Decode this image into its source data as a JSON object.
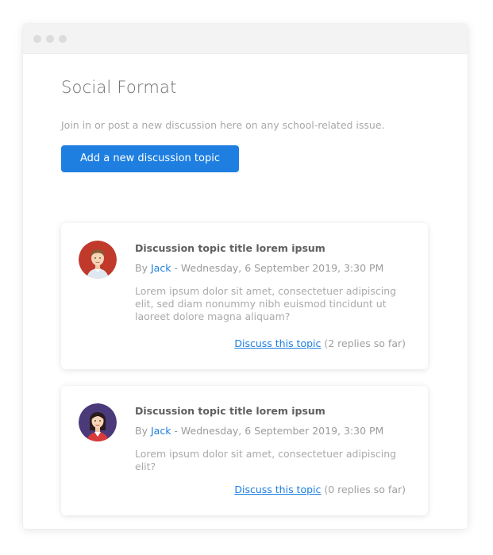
{
  "page": {
    "title": "Social Format",
    "intro": "Join in or post a new discussion here on any school-related issue.",
    "add_button": "Add a new discussion topic"
  },
  "topics": [
    {
      "title": "Discussion topic title lorem ipsum",
      "by": "By",
      "author": "Jack",
      "date": "- Wednesday, 6 September 2019, 3:30 PM",
      "excerpt": "Lorem ipsum dolor sit amet, consectetuer adipiscing elit, sed diam nonummy nibh euismod tincidunt ut laoreet dolore magna aliquam?",
      "discuss_link": "Discuss this topic",
      "replies": "(2 replies so far)",
      "avatar": "male-avatar-icon"
    },
    {
      "title": "Discussion topic title lorem ipsum",
      "by": "By",
      "author": "Jack",
      "date": "- Wednesday, 6 September 2019, 3:30 PM",
      "excerpt": "Lorem ipsum dolor sit amet, consectetuer adipiscing elit?",
      "discuss_link": "Discuss this topic",
      "replies": "(0 replies so far)",
      "avatar": "female-avatar-icon"
    }
  ],
  "colors": {
    "accent": "#1e7fe0",
    "avatar_bg_1": "#c0392b",
    "avatar_bg_2": "#4a3a7a"
  }
}
